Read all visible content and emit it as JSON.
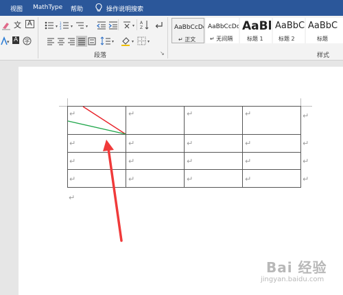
{
  "menu": {
    "items": [
      "视图",
      "MathType",
      "帮助"
    ],
    "search_hint": "操作说明搜索"
  },
  "ribbon": {
    "paragraph_group_label": "段落",
    "styles_group_label": "样式",
    "font_color_glyph": "A",
    "highlight_glyph": "A",
    "charborder_glyph": "A",
    "phonetic_glyph": "文",
    "enclose_glyph": "字",
    "launcher_glyph": "↘"
  },
  "styles": [
    {
      "sample": "AaBbCcDc",
      "name": "↵ 正文"
    },
    {
      "sample": "AaBbCcDc",
      "name": "↵ 无间隔"
    },
    {
      "sample": "AaBl",
      "name": "标题 1"
    },
    {
      "sample": "AaBbC",
      "name": "标题 2"
    },
    {
      "sample": "AaBbC",
      "name": "标题"
    }
  ],
  "document": {
    "cell_marker": "↵",
    "table_rows": 4,
    "table_cols": 4
  },
  "watermark": {
    "logo": "Bai 经验",
    "url": "jingyan.baidu.com"
  },
  "colors": {
    "accent_blue": "#2b579a",
    "diag_red": "#e8232a",
    "diag_green": "#1fa64a",
    "arrow_red": "#f03a3a"
  }
}
